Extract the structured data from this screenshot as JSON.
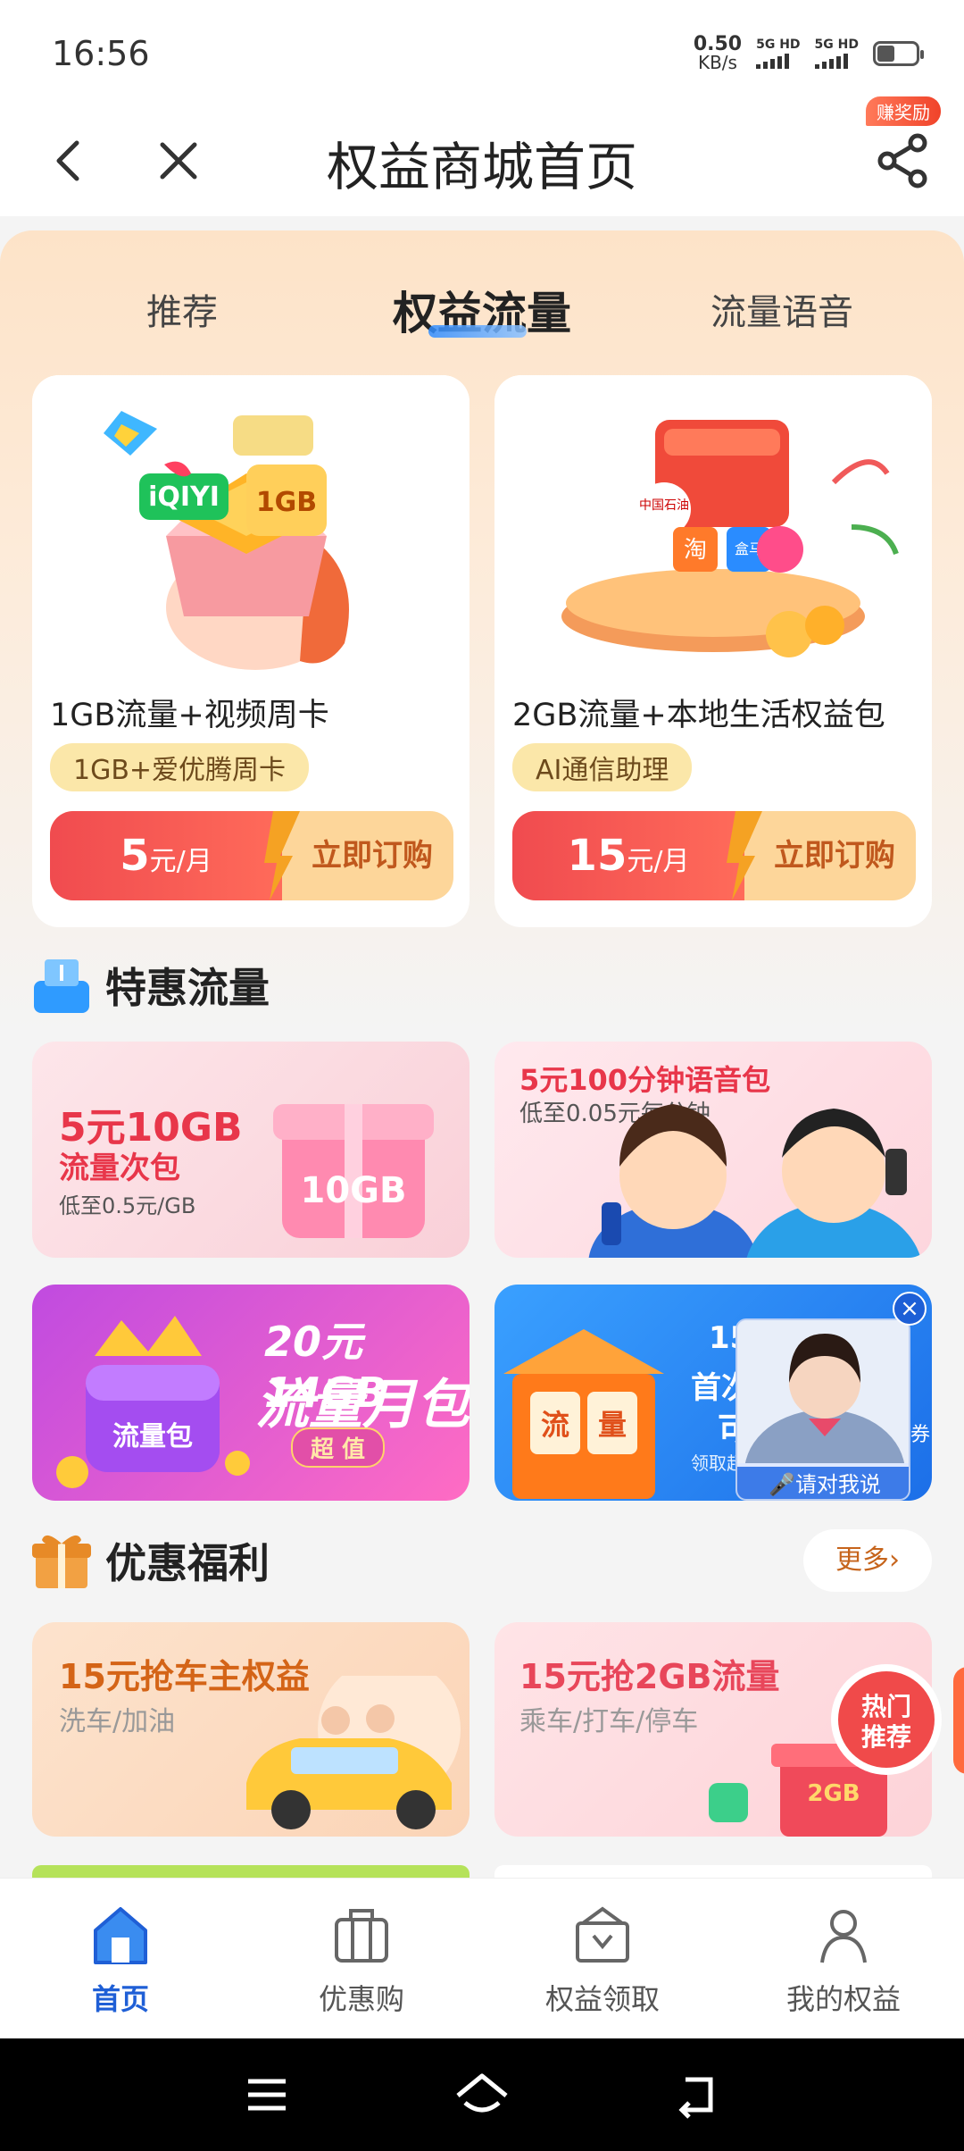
{
  "status_bar": {
    "time": "16:56",
    "speed_value": "0.50",
    "speed_unit": "KB/s",
    "sim1_label": "5G HD",
    "sim2_label": "5G HD"
  },
  "nav": {
    "title": "权益商城首页",
    "reward_badge": "赚奖励"
  },
  "tabs": [
    "推荐",
    "权益流量",
    "流量语音"
  ],
  "products": [
    {
      "title": "1GB流量+视频周卡",
      "tag": "1GB+爱优腾周卡",
      "price": "5",
      "price_unit": "元/月",
      "action": "立即订购",
      "img_labels": {
        "brand": "iQIYI",
        "gb": "1GB"
      }
    },
    {
      "title": "2GB流量+本地生活权益包",
      "tag": "AI通信助理",
      "price": "15",
      "price_unit": "元/月",
      "action": "立即订购",
      "img_labels": {
        "badge1": "中国石油",
        "badge2": "淘",
        "badge3": "盒马"
      }
    }
  ],
  "section_discount": {
    "title": "特惠流量",
    "promos": [
      {
        "line1": "5元10GB",
        "line2": "流量次包",
        "line3": "低至0.5元/GB",
        "gift_label": "10GB"
      },
      {
        "line1": "5元100分钟语音包",
        "line2": "低至0.05元每分钟"
      },
      {
        "line1": "20元14GB",
        "line2": "流量月包",
        "line3": "超 值",
        "box_label": "流量包"
      },
      {
        "line1": "15",
        "line2": "首次",
        "line3": "可",
        "line4": "领取超",
        "block1": "流",
        "block2": "量",
        "voice_label": "请对我说",
        "side_text": "券"
      }
    ]
  },
  "section_welfare": {
    "title": "优惠福利",
    "more": "更多",
    "cards": [
      {
        "title": "15元抢车主权益",
        "subtitle": "洗车/加油"
      },
      {
        "title": "15元抢2GB流量",
        "subtitle": "乘车/打车/停车",
        "gift_label": "2GB"
      }
    ]
  },
  "floating": {
    "line1": "热门",
    "line2": "推荐"
  },
  "bottom_nav": [
    {
      "label": "首页",
      "icon": "home-icon",
      "active": true
    },
    {
      "label": "优惠购",
      "icon": "briefcase-icon",
      "active": false
    },
    {
      "label": "权益领取",
      "icon": "claim-box-icon",
      "active": false
    },
    {
      "label": "我的权益",
      "icon": "user-icon",
      "active": false
    }
  ],
  "colors": {
    "accent_blue": "#1f5fd6",
    "price_red": "#f04b4f",
    "action_orange": "#c0581d",
    "panel_peach": "#fde3c8"
  }
}
